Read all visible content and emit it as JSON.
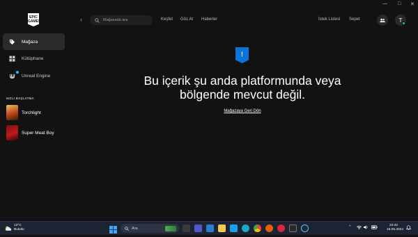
{
  "logo": {
    "text": "EPIC GAMES"
  },
  "sidebar": {
    "items": [
      {
        "label": "Mağaza"
      },
      {
        "label": "Kütüphane"
      },
      {
        "label": "Unreal Engine"
      }
    ],
    "section_label": "HIZLI BAŞLATMA",
    "games": [
      {
        "label": "Torchlight"
      },
      {
        "label": "Super Meat Boy"
      }
    ]
  },
  "header": {
    "search_placeholder": "Mağazada ara",
    "nav": [
      "Keşfet",
      "Göz At",
      "Haberler"
    ],
    "wishlist": "İstek Listesi",
    "cart": "Sepet",
    "avatar_initial": "T"
  },
  "main": {
    "alert_glyph": "!",
    "message": "Bu içerik şu anda platformunda veya bölgende mevcut değil.",
    "back_link": "Mağazaya Geri Dön"
  },
  "taskbar": {
    "weather_temp": "13°C",
    "weather_desc": "Bulutlu",
    "search_label": "Ara",
    "time": "23:32",
    "date": "16.05.2024"
  },
  "colors": {
    "accent": "#0a74da",
    "background": "#121212",
    "online": "#20d07a"
  }
}
